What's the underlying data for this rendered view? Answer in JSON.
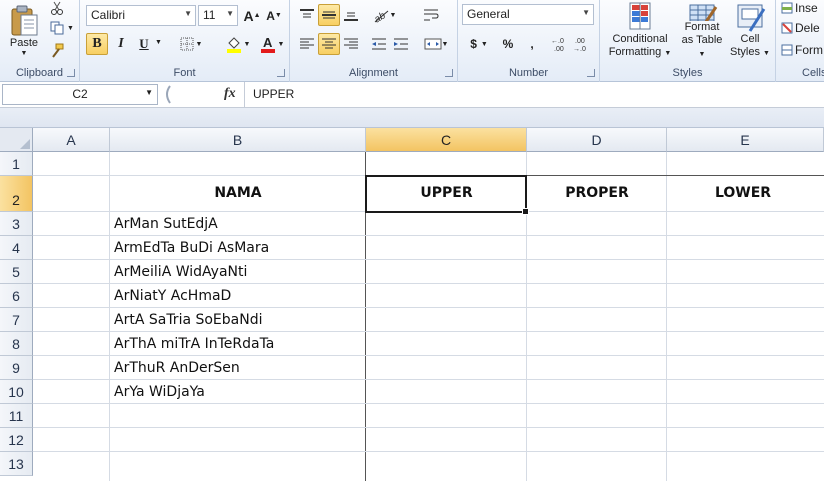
{
  "ribbon": {
    "clipboard": {
      "paste_label": "Paste",
      "group_label": "Clipboard"
    },
    "font": {
      "font_name": "Calibri",
      "font_size": "11",
      "bold": "B",
      "italic": "I",
      "underline": "U",
      "group_label": "Font"
    },
    "alignment": {
      "group_label": "Alignment"
    },
    "number": {
      "format": "General",
      "currency": "$",
      "percent": "%",
      "comma": ",",
      "group_label": "Number"
    },
    "styles": {
      "conditional_formatting": [
        "Conditional",
        "Formatting"
      ],
      "format_as_table": [
        "Format",
        "as Table"
      ],
      "cell_styles": [
        "Cell",
        "Styles"
      ],
      "group_label": "Styles"
    },
    "cells": {
      "insert": "Inse",
      "delete": "Dele",
      "format": "Form",
      "group_label": "Cells"
    }
  },
  "formula_bar": {
    "name_box": "C2",
    "fx": "fx",
    "formula": "UPPER"
  },
  "grid": {
    "columns": [
      "A",
      "B",
      "C",
      "D",
      "E"
    ],
    "rows": [
      "1",
      "2",
      "3",
      "4",
      "5",
      "6",
      "7",
      "8",
      "9",
      "10",
      "11",
      "12",
      "13"
    ],
    "selected_column": "C",
    "selected_row": "2",
    "headers": {
      "nama": "NAMA",
      "upper": "UPPER",
      "proper": "PROPER",
      "lower": "LOWER"
    },
    "names": [
      "ArMan SutEdjA",
      "ArmEdTa BuDi AsMara",
      "ArMeiliA WidAyaNti",
      "ArNiatY AcHmaD",
      "ArtA SaTria SoEbaNdi",
      "ArThA miTrA InTeRdaTa",
      "ArThuR AnDerSen",
      "ArYa WiDjaYa"
    ]
  },
  "colors": {
    "selection_header": "#f3c462",
    "ribbon_bg": "#e4ecf7",
    "grid_line": "#d5dbe4"
  }
}
